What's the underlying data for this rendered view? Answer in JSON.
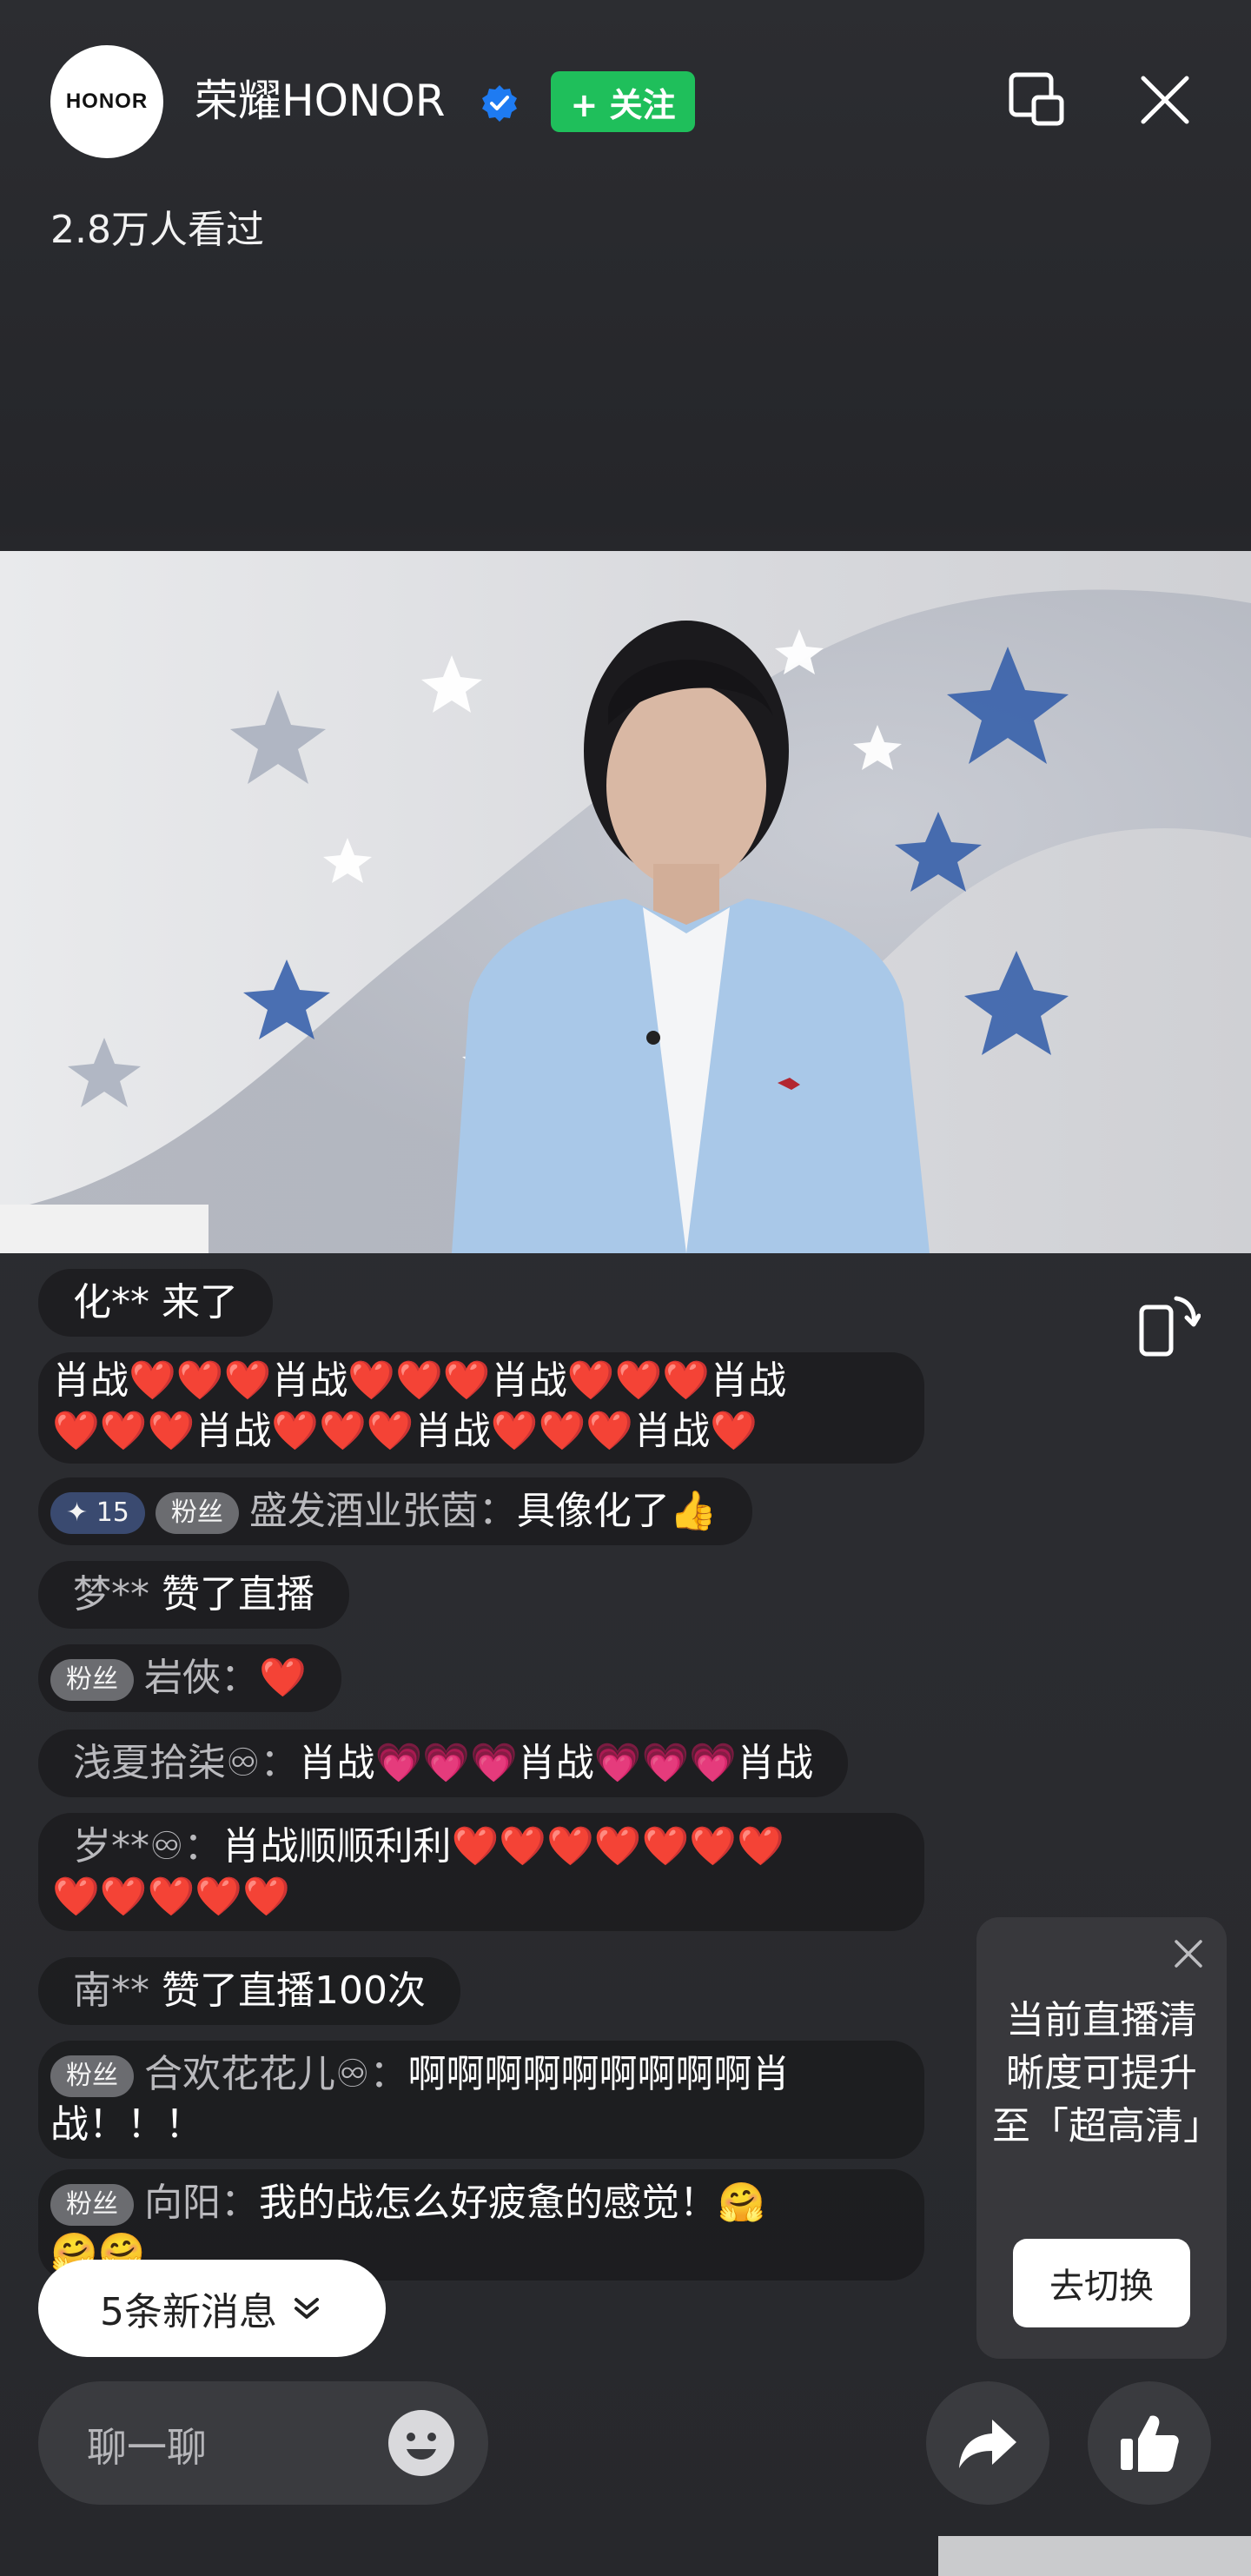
{
  "header": {
    "logo_text": "HONOR",
    "account_name": "荣耀HONOR",
    "follow_label": "+ 关注",
    "viewers": "2.8万人看过"
  },
  "chat": {
    "messages": [
      {
        "text": "化** 来了"
      },
      {
        "line1": "肖战❤️❤️❤️肖战❤️❤️❤️肖战❤️❤️❤️肖战",
        "line2": "❤️❤️❤️肖战❤️❤️❤️肖战❤️❤️❤️肖战❤️"
      },
      {
        "badge_level": "15",
        "badge": "粉丝",
        "user": "盛发酒业张茵：",
        "text": "具像化了👍"
      },
      {
        "user": "梦**",
        "text": "赞了直播"
      },
      {
        "badge": "粉丝",
        "user": "岩俠：",
        "text": "❤️"
      },
      {
        "user": "浅夏拾柒♾：",
        "text": "肖战💗💗💗肖战💗💗💗肖战"
      },
      {
        "user": "岁**♾：",
        "line1": "肖战顺顺利利❤️❤️❤️❤️❤️❤️❤️",
        "line2": "❤️❤️❤️❤️❤️"
      },
      {
        "user": "南**",
        "text": "赞了直播100次"
      },
      {
        "badge": "粉丝",
        "user": "合欢花花儿♾：",
        "line1": "啊啊啊啊啊啊啊啊啊肖",
        "line2": "战！！！"
      },
      {
        "badge": "粉丝",
        "user": "向阳：",
        "text": "我的战怎么好疲惫的感觉！🤗",
        "line2": "🤗🤗"
      }
    ],
    "new_messages": "5条新消息"
  },
  "clarity_prompt": {
    "text": "当前直播清晰度可提升至「超高清」",
    "button": "去切换"
  },
  "bottom": {
    "input_placeholder": "聊一聊"
  },
  "icons": [
    "verified-icon",
    "pip-icon",
    "close-icon",
    "rotate-icon",
    "chevron-down-icon",
    "emoji-icon",
    "share-icon",
    "like-icon"
  ]
}
